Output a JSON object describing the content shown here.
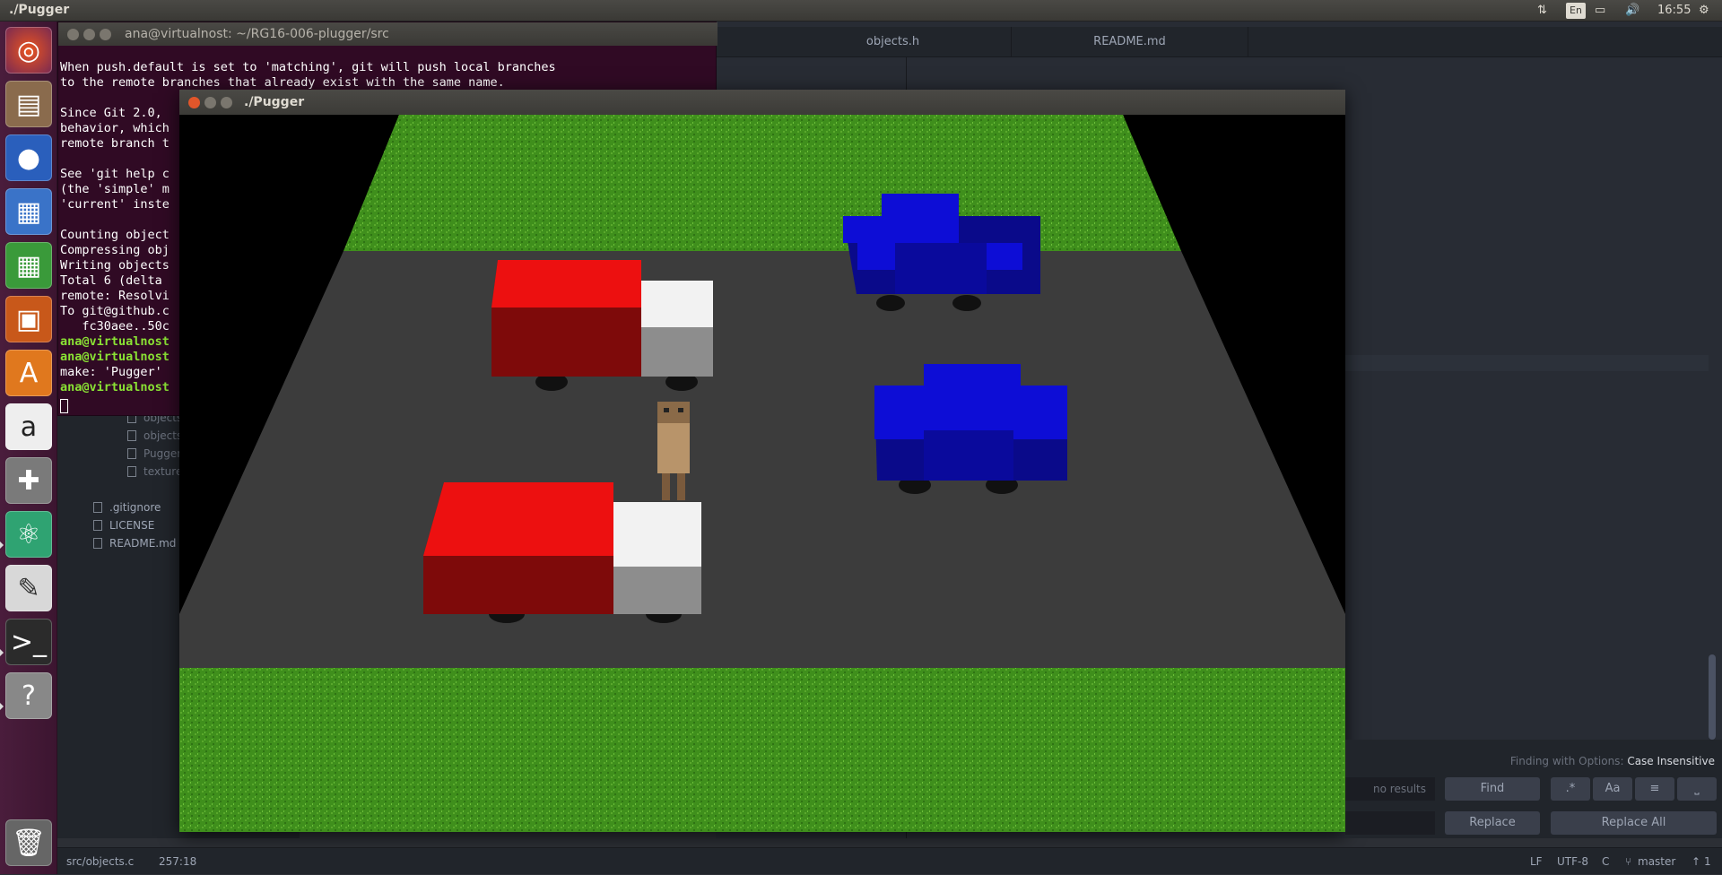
{
  "topbar": {
    "title": "./Pugger",
    "lang": "En",
    "time": "16:55",
    "icons": [
      "network-icon",
      "battery-icon",
      "volume-icon",
      "gear-icon"
    ]
  },
  "launcher": {
    "items": [
      "ubuntu-dash-icon",
      "files-icon",
      "firefox-icon",
      "writer-icon",
      "calc-icon",
      "impress-icon",
      "software-center-icon",
      "amazon-icon",
      "settings-icon",
      "atom-icon",
      "text-editor-icon",
      "terminal-icon",
      "help-icon",
      "trash-icon"
    ]
  },
  "editor": {
    "tabs": [
      "objects.h",
      "README.md"
    ]
  },
  "tree": {
    "items": [
      {
        "label": "objects.h",
        "dim": true
      },
      {
        "label": "objects.o",
        "dim": true
      },
      {
        "label": "Pugger",
        "dim": true
      },
      {
        "label": "texture.o",
        "dim": true
      },
      {
        "label": ".gitignore",
        "dim": false
      },
      {
        "label": "LICENSE",
        "dim": false
      },
      {
        "label": "README.md",
        "dim": false
      }
    ]
  },
  "terminal": {
    "title": "ana@virtualnost: ~/RG16-006-plugger/src",
    "lines": [
      {
        "t": "When push.default is set to 'matching', git will push local branches",
        "g": false
      },
      {
        "t": "to the remote branches that already exist with the same name.",
        "g": false
      },
      {
        "t": "",
        "g": false
      },
      {
        "t": "Since Git 2.0,",
        "g": false
      },
      {
        "t": "behavior, which",
        "g": false
      },
      {
        "t": "remote branch t",
        "g": false
      },
      {
        "t": "",
        "g": false
      },
      {
        "t": "See 'git help c",
        "g": false
      },
      {
        "t": "(the 'simple' m",
        "g": false
      },
      {
        "t": "'current' inste",
        "g": false
      },
      {
        "t": "",
        "g": false
      },
      {
        "t": "Counting object",
        "g": false
      },
      {
        "t": "Compressing obj",
        "g": false
      },
      {
        "t": "Writing objects",
        "g": false
      },
      {
        "t": "Total 6 (delta",
        "g": false
      },
      {
        "t": "remote: Resolvi",
        "g": false
      },
      {
        "t": "To git@github.c",
        "g": false
      },
      {
        "t": "   fc30aee..50c",
        "g": false
      },
      {
        "t": "ana@virtualnost",
        "g": true
      },
      {
        "t": "ana@virtualnost",
        "g": true
      },
      {
        "t": "make: 'Pugger'",
        "g": false
      },
      {
        "t": "ana@virtualnost",
        "g": true
      }
    ]
  },
  "pugger": {
    "title": "./Pugger"
  },
  "find": {
    "options_label": "Finding with Options:",
    "options_value": "Case Insensitive",
    "results": "no results",
    "find_label": "Find",
    "replace_label": "Replace",
    "replace_all_label": "Replace All",
    "regex_label": ".*",
    "case_label": "Aa"
  },
  "status": {
    "file": "src/objects.c",
    "cursor": "257:18",
    "eol": "LF",
    "encoding": "UTF-8",
    "grammar": "C",
    "branch": "master",
    "push_count": "1"
  },
  "colors": {
    "grass": "#3f8f1c",
    "road": "#3c3c3c",
    "truck_red": "#e01010",
    "truck_white": "#f0f0f0",
    "car_blue": "#0d0dd6"
  }
}
